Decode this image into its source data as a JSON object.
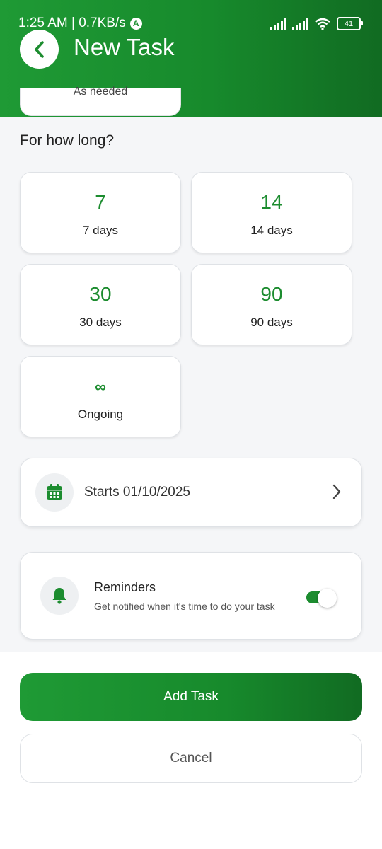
{
  "status_bar": {
    "time": "1:25 AM | 0.7KB/s",
    "indicator": "A",
    "battery": "41"
  },
  "header": {
    "title": "New Task",
    "previous_option": "As needed"
  },
  "duration": {
    "heading": "For how long?",
    "options": [
      {
        "value": "7",
        "label": "7 days"
      },
      {
        "value": "14",
        "label": "14 days"
      },
      {
        "value": "30",
        "label": "30 days"
      },
      {
        "value": "90",
        "label": "90 days"
      },
      {
        "value": "∞",
        "label": "Ongoing"
      }
    ]
  },
  "start": {
    "text": "Starts 01/10/2025"
  },
  "reminders": {
    "title": "Reminders",
    "subtitle": "Get notified when it's time to do your task",
    "enabled": true
  },
  "actions": {
    "add_label": "Add Task",
    "cancel_label": "Cancel"
  },
  "colors": {
    "brand_green": "#1c8c2f",
    "background": "#f5f6f8"
  }
}
